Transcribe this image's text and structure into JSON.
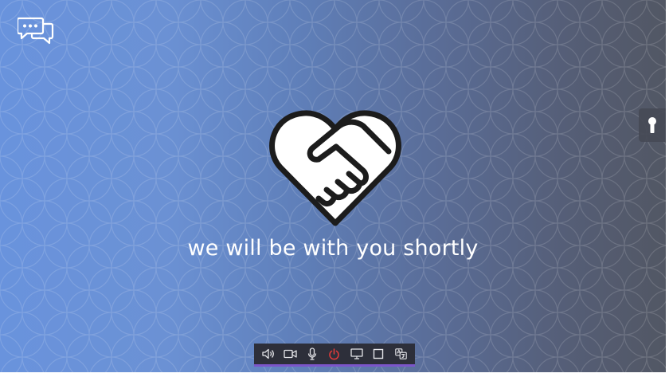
{
  "message": {
    "text": "we will be with you shortly"
  },
  "icons": {
    "chat": "chat-bubbles-icon",
    "lock": "keyhole-icon",
    "heart": "handshake-heart-icon"
  },
  "toolbar": {
    "buttons": [
      {
        "icon": "speaker-icon",
        "label": "Speaker"
      },
      {
        "icon": "camera-icon",
        "label": "Camera"
      },
      {
        "icon": "microphone-icon",
        "label": "Microphone"
      },
      {
        "icon": "power-icon",
        "label": "End session",
        "color": "#e03a3a"
      },
      {
        "icon": "screen-share-icon",
        "label": "Share screen"
      },
      {
        "icon": "fullscreen-icon",
        "label": "Full screen"
      },
      {
        "icon": "translate-icon",
        "label": "Language"
      }
    ],
    "accent": "#7b55c9"
  },
  "colors": {
    "gradient_left": "#6993dd",
    "gradient_right": "#525764",
    "toolbar_bg": "#2d2f3a"
  }
}
